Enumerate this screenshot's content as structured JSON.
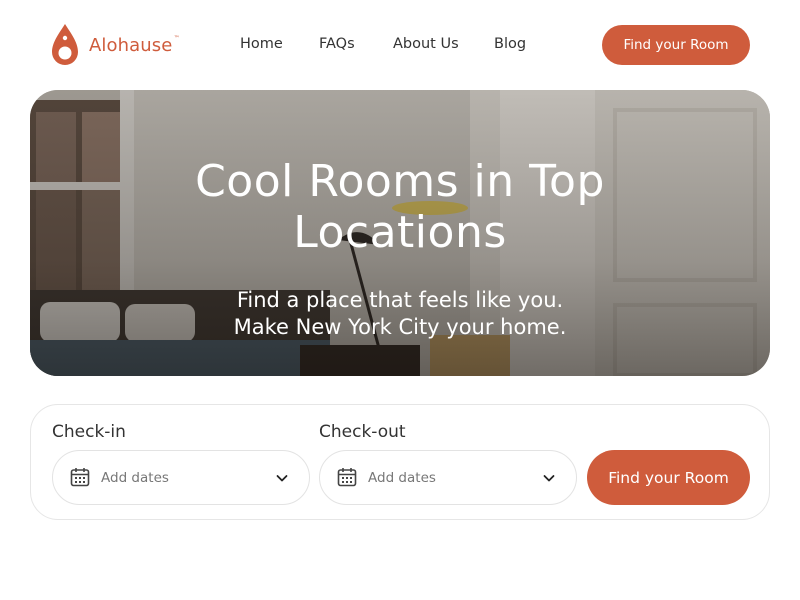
{
  "brand": {
    "name": "Alohause",
    "tm": "™",
    "accent_color": "#cf5c3c"
  },
  "nav": {
    "items": [
      {
        "label": "Home"
      },
      {
        "label": "FAQs"
      },
      {
        "label": "About Us"
      },
      {
        "label": "Blog"
      }
    ],
    "cta_label": "Find your Room"
  },
  "hero": {
    "title_line1": "Cool Rooms in Top",
    "title_line2": "Locations",
    "subtitle_line1": "Find a place that feels like you.",
    "subtitle_line2": "Make New York City your home.",
    "image": "bedroom-photo"
  },
  "booking": {
    "checkin": {
      "label": "Check-in",
      "placeholder": "Add dates",
      "icon": "calendar-icon"
    },
    "checkout": {
      "label": "Check-out",
      "placeholder": "Add dates",
      "icon": "calendar-icon"
    },
    "dropdown_icon": "chevron-down-icon",
    "submit_label": "Find your Room"
  }
}
